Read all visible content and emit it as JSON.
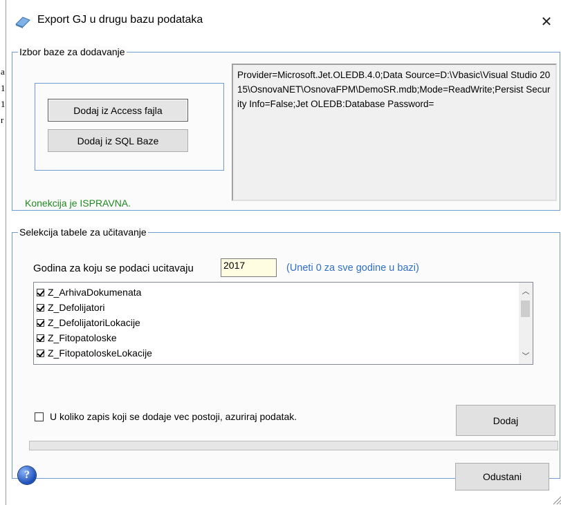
{
  "background": {
    "fragments": [
      "a",
      "1",
      "1",
      "r"
    ]
  },
  "window": {
    "title": "Export GJ u drugu bazu podataka",
    "close_icon": "close-icon"
  },
  "db_group": {
    "legend": "Izbor baze za dodavanje",
    "access_button": "Dodaj iz Access fajla",
    "sql_button": "Dodaj iz SQL Baze",
    "connection_string": "Provider=Microsoft.Jet.OLEDB.4.0;Data Source=D:\\Vbasic\\Visual Studio 2015\\OsnovaNET\\OsnovaFPM\\DemoSR.mdb;Mode=ReadWrite;Persist Security Info=False;Jet OLEDB:Database Password=",
    "status": "Konekcija je ISPRAVNA."
  },
  "table_group": {
    "legend": "Selekcija tabele za učitavanje",
    "year_label": "Godina za koju se podaci ucitavaju",
    "year_value": "2017",
    "year_hint": "(Uneti 0 za sve godine u bazi)",
    "tables": [
      {
        "name": "Z_ArhivaDokumenata",
        "checked": true
      },
      {
        "name": "Z_Defolijatori",
        "checked": true
      },
      {
        "name": "Z_DefolijatoriLokacije",
        "checked": true
      },
      {
        "name": "Z_Fitopatoloske",
        "checked": true
      },
      {
        "name": "Z_FitopatoloskeLokacije",
        "checked": true
      }
    ],
    "update_label": "U koliko zapis koji se dodaje vec postoji, azuriraj podatak.",
    "update_checked": false,
    "add_button": "Dodaj",
    "progress": 0
  },
  "footer": {
    "help_icon": "help-icon",
    "help_glyph": "?",
    "cancel_button": "Odustani"
  },
  "colors": {
    "status_ok": "#1e8a1e",
    "hint": "#2f6fc6",
    "group_border": "#6d9bd4",
    "year_bg": "#fffde1"
  }
}
